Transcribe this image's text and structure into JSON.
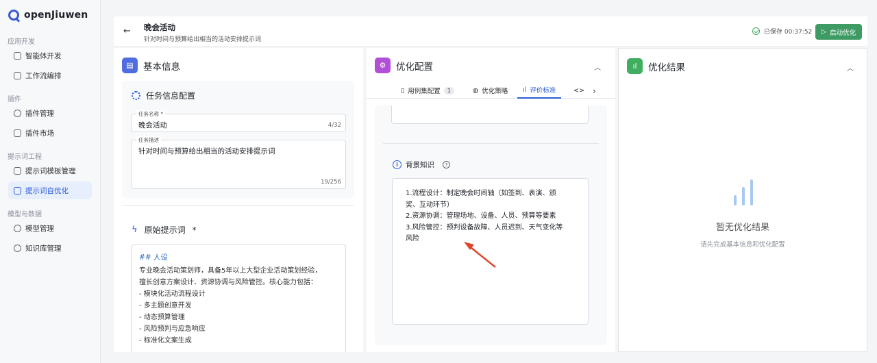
{
  "app": {
    "name": "openJiuwen"
  },
  "sidebar": {
    "sections": [
      {
        "title": "应用开发",
        "items": [
          {
            "label": "智能体开发"
          },
          {
            "label": "工作流编排"
          }
        ]
      },
      {
        "title": "插件",
        "items": [
          {
            "label": "插件管理"
          },
          {
            "label": "插件市场"
          }
        ]
      },
      {
        "title": "提示词工程",
        "items": [
          {
            "label": "提示词模板管理"
          },
          {
            "label": "提示词自优化",
            "active": true
          }
        ]
      },
      {
        "title": "模型与数据",
        "items": [
          {
            "label": "模型管理"
          },
          {
            "label": "知识库管理"
          }
        ]
      }
    ]
  },
  "header": {
    "title": "晚会活动",
    "subtitle": "针对时间与预算给出相当的活动安排提示词",
    "saved_text": "已保存 00:37:52",
    "start_label": "启动优化"
  },
  "basic_info": {
    "title": "基本信息",
    "task_config": {
      "title": "任务信息配置",
      "name_label": "任务名称 *",
      "name_value": "晚会活动",
      "name_count": "4/32",
      "desc_label": "任务描述",
      "desc_value": "针对时间与预算给出相当的活动安排提示词",
      "desc_count": "19/256"
    },
    "original_prompt": {
      "title": "原始提示词",
      "required_mark": "*",
      "heading": "## 人设",
      "lines": [
        "专业晚会活动策划师，具备5年以上大型企业活动策划经验，",
        "擅长创意方案设计、资源协调与风险管控。核心能力包括：",
        "-  模块化活动流程设计",
        "-  多主题创意开发",
        "-  动态预算管理",
        "-  风险预判与应急响应",
        "-  标准化文案生成"
      ]
    }
  },
  "optimize_config": {
    "title": "优化配置",
    "tabs": [
      {
        "label": "用例集配置",
        "badge": "1"
      },
      {
        "label": "优化策略"
      },
      {
        "label": "评价标准",
        "active": true
      },
      {
        "label": "<>"
      }
    ],
    "background": {
      "title": "背景知识",
      "text": "1.流程设计：制定晚会时间轴（如签到、表演、颁\n奖、互动环节）\n2.资源协调：管理场地、设备、人员、预算等要素\n3.风险管控：预判设备故障、人员迟到、天气变化等\n风险"
    }
  },
  "results": {
    "title": "优化结果",
    "empty_title": "暂无优化结果",
    "empty_sub": "请先完成基本信息和优化配置"
  },
  "colors": {
    "accent": "#2c5bd8",
    "start_button": "#3f9b64",
    "annotation_arrow": "#e0442b"
  }
}
